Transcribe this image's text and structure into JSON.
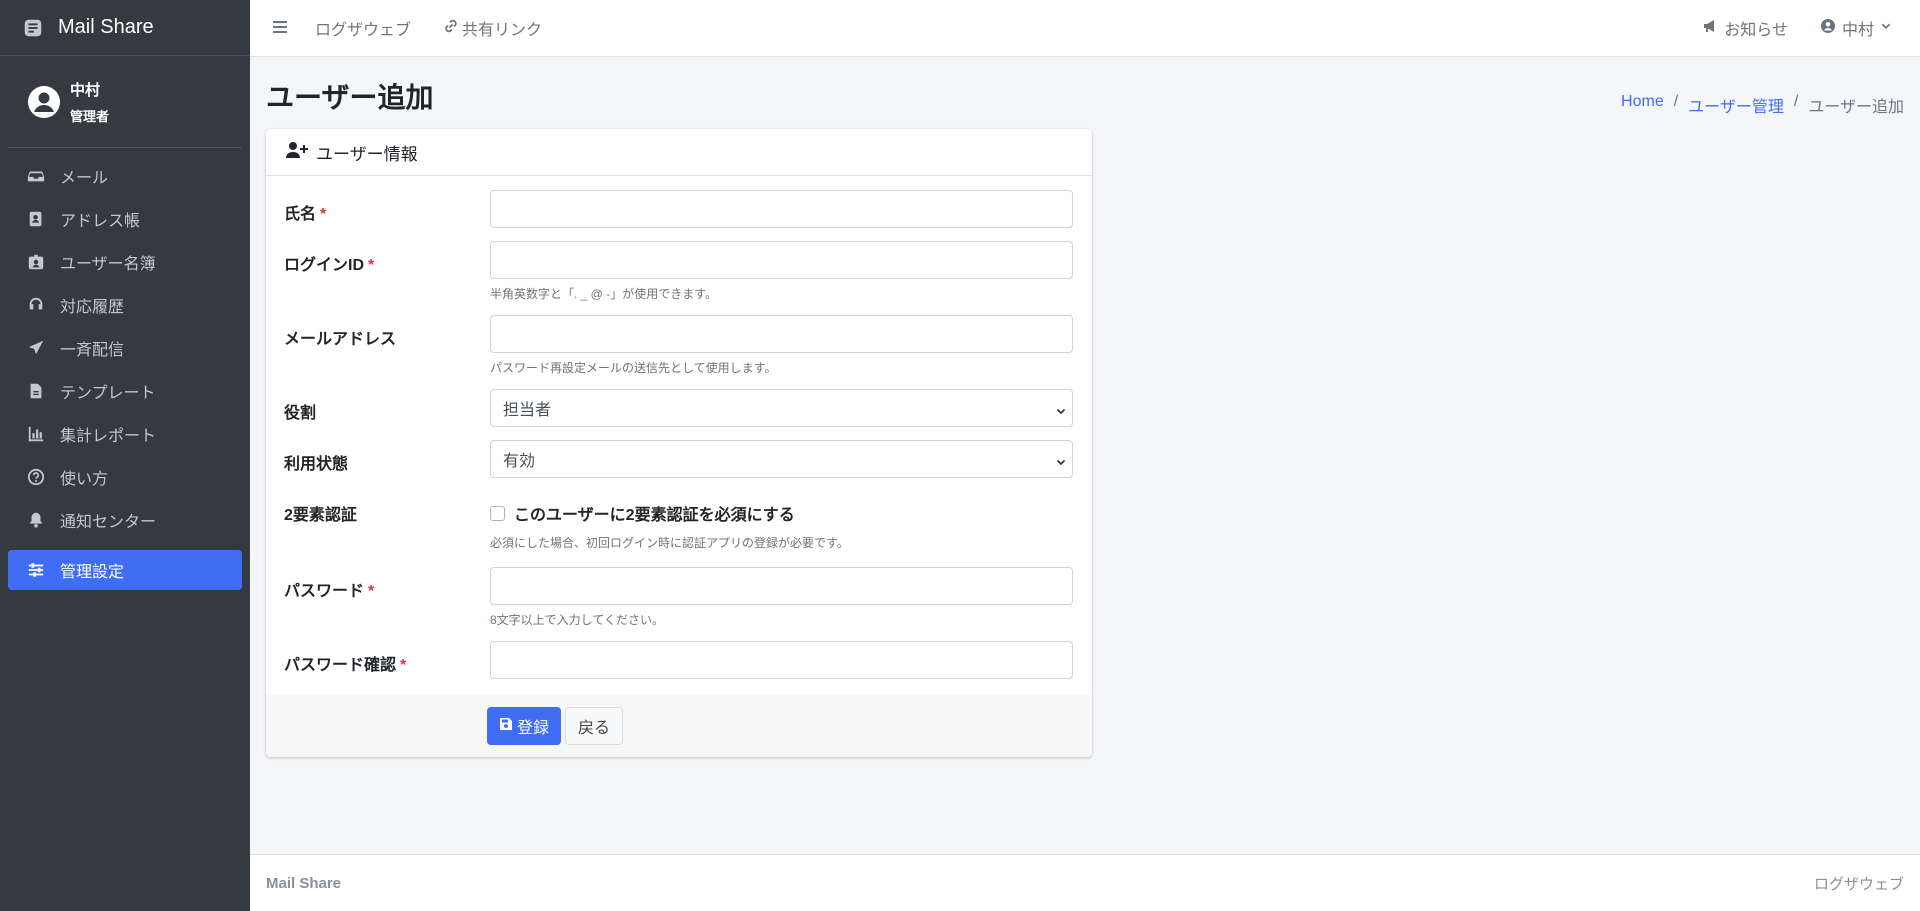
{
  "sidebar": {
    "brand": "Mail Share",
    "user": {
      "name": "中村",
      "role": "管理者"
    },
    "items": [
      {
        "label": "メール",
        "icon": "inbox-icon"
      },
      {
        "label": "アドレス帳",
        "icon": "address-book-icon"
      },
      {
        "label": "ユーザー名簿",
        "icon": "id-badge-icon"
      },
      {
        "label": "対応履歴",
        "icon": "headset-icon"
      },
      {
        "label": "一斉配信",
        "icon": "paper-plane-icon"
      },
      {
        "label": "テンプレート",
        "icon": "file-icon"
      },
      {
        "label": "集計レポート",
        "icon": "chart-bar-icon"
      },
      {
        "label": "使い方",
        "icon": "question-circle-icon"
      },
      {
        "label": "通知センター",
        "icon": "bell-icon"
      },
      {
        "label": "管理設定",
        "icon": "sliders-icon",
        "active": true
      }
    ]
  },
  "navbar": {
    "links": [
      "ログザウェブ",
      "共有リンク"
    ],
    "notice": "お知らせ",
    "user": "中村"
  },
  "header": {
    "title": "ユーザー追加",
    "breadcrumb": [
      "Home",
      "ユーザー管理",
      "ユーザー追加"
    ]
  },
  "card": {
    "title": "ユーザー情報",
    "fields": {
      "name": {
        "label": "氏名",
        "required": "*",
        "value": ""
      },
      "login_id": {
        "label": "ログインID",
        "required": "*",
        "value": "",
        "help": "半角英数字と「. _ @ -」が使用できます。"
      },
      "email": {
        "label": "メールアドレス",
        "value": "",
        "help": "パスワード再設定メールの送信先として使用します。"
      },
      "role": {
        "label": "役割",
        "selected": "担当者"
      },
      "status": {
        "label": "利用状態",
        "selected": "有効"
      },
      "twofa": {
        "label": "2要素認証",
        "checkbox_label": "このユーザーに2要素認証を必須にする",
        "checked": false,
        "help": "必須にした場合、初回ログイン時に認証アプリの登録が必要です。"
      },
      "password": {
        "label": "パスワード",
        "required": "*",
        "value": "",
        "help": "8文字以上で入力してください。"
      },
      "password_confirm": {
        "label": "パスワード確認",
        "required": "*",
        "value": ""
      }
    },
    "buttons": {
      "submit": "登録",
      "back": "戻る"
    }
  },
  "footer": {
    "left": "Mail Share",
    "right": "ログザウェブ"
  },
  "colors": {
    "primary": "#3f6df5",
    "sidebar": "#343a40",
    "required": "#dc3545"
  }
}
